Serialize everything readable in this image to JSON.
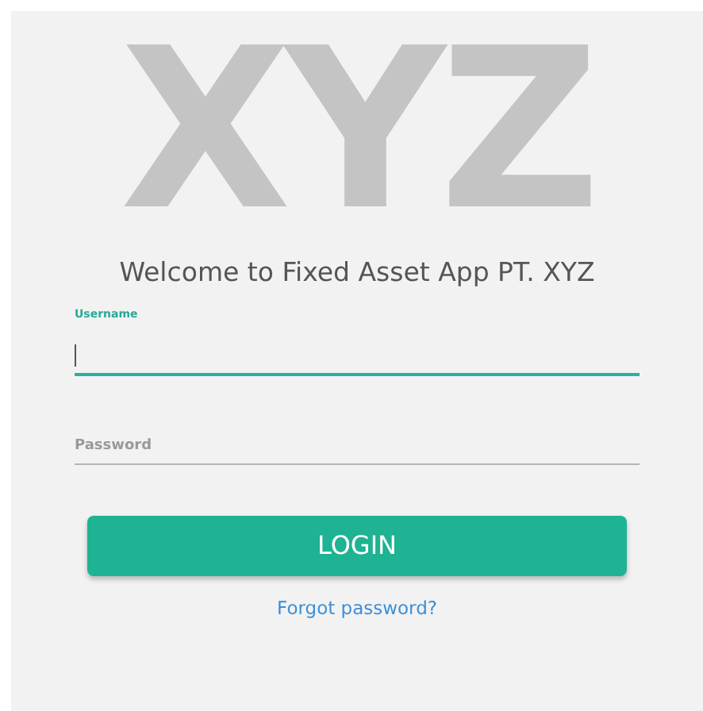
{
  "logo": {
    "text": "XYZ"
  },
  "title": "Welcome to Fixed Asset App PT. XYZ",
  "fields": [
    {
      "label": "Username",
      "focused": true
    },
    {
      "label": "Password",
      "focused": false
    }
  ],
  "login_button": "LOGIN",
  "forgot_link": "Forgot password?"
}
